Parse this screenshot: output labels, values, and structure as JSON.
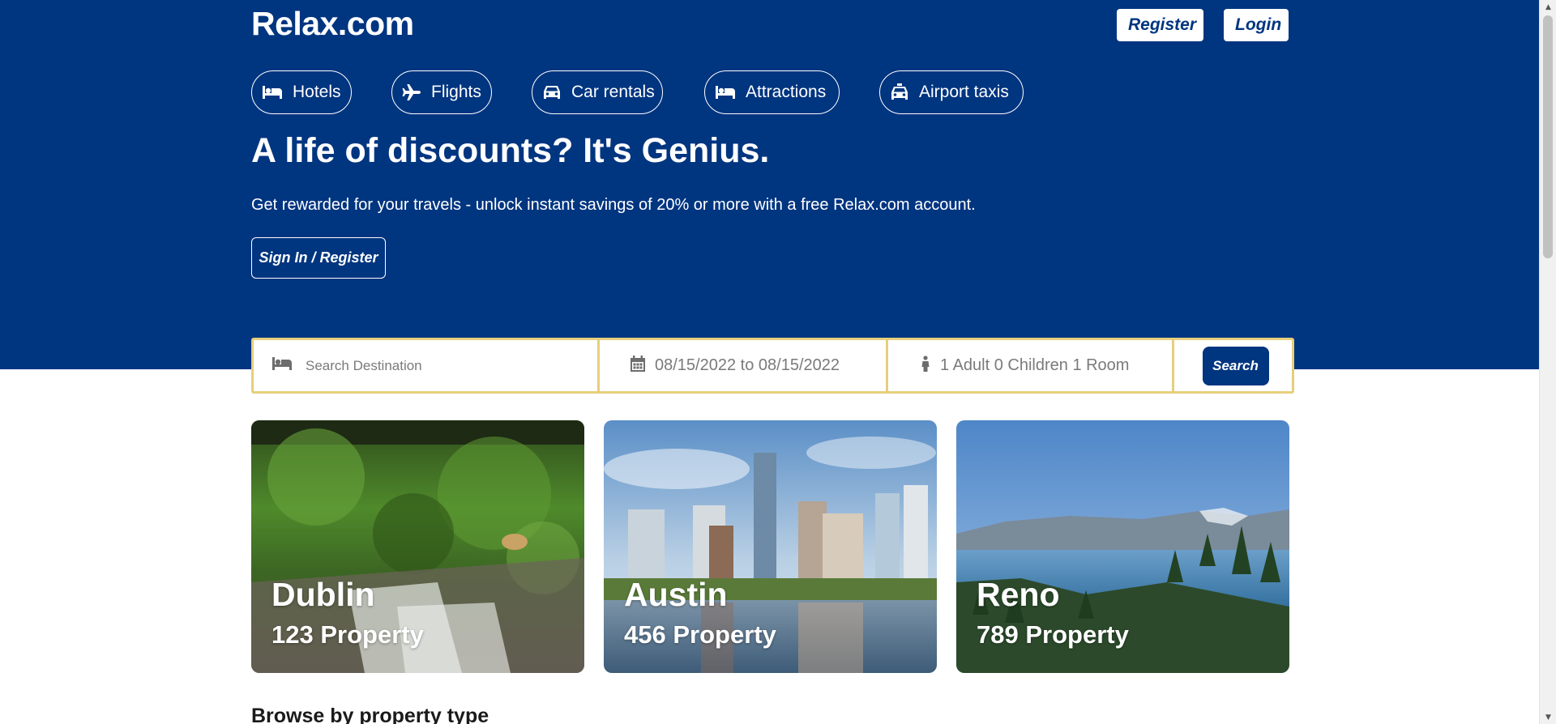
{
  "header": {
    "logo": "Relax.com",
    "register_label": "Register",
    "login_label": "Login"
  },
  "nav": {
    "items": [
      {
        "label": "Hotels",
        "icon": "bed-icon"
      },
      {
        "label": "Flights",
        "icon": "plane-icon"
      },
      {
        "label": "Car rentals",
        "icon": "car-icon"
      },
      {
        "label": "Attractions",
        "icon": "bed-icon"
      },
      {
        "label": "Airport taxis",
        "icon": "taxi-icon"
      }
    ]
  },
  "hero": {
    "headline": "A life of discounts? It's Genius.",
    "subline": "Get rewarded for your travels - unlock instant savings of 20% or more with a free Relax.com account.",
    "signin_label": "Sign In / Register"
  },
  "search": {
    "destination_placeholder": "Search Destination",
    "dates": "08/15/2022 to 08/15/2022",
    "guests": "1 Adult 0 Children 1 Room",
    "button_label": "Search"
  },
  "destinations": [
    {
      "city": "Dublin",
      "properties": "123 Property"
    },
    {
      "city": "Austin",
      "properties": "456 Property"
    },
    {
      "city": "Reno",
      "properties": "789 Property"
    }
  ],
  "browse": {
    "title": "Browse by property type"
  },
  "colors": {
    "brand": "#003580",
    "search_border": "#e6cf7c"
  }
}
